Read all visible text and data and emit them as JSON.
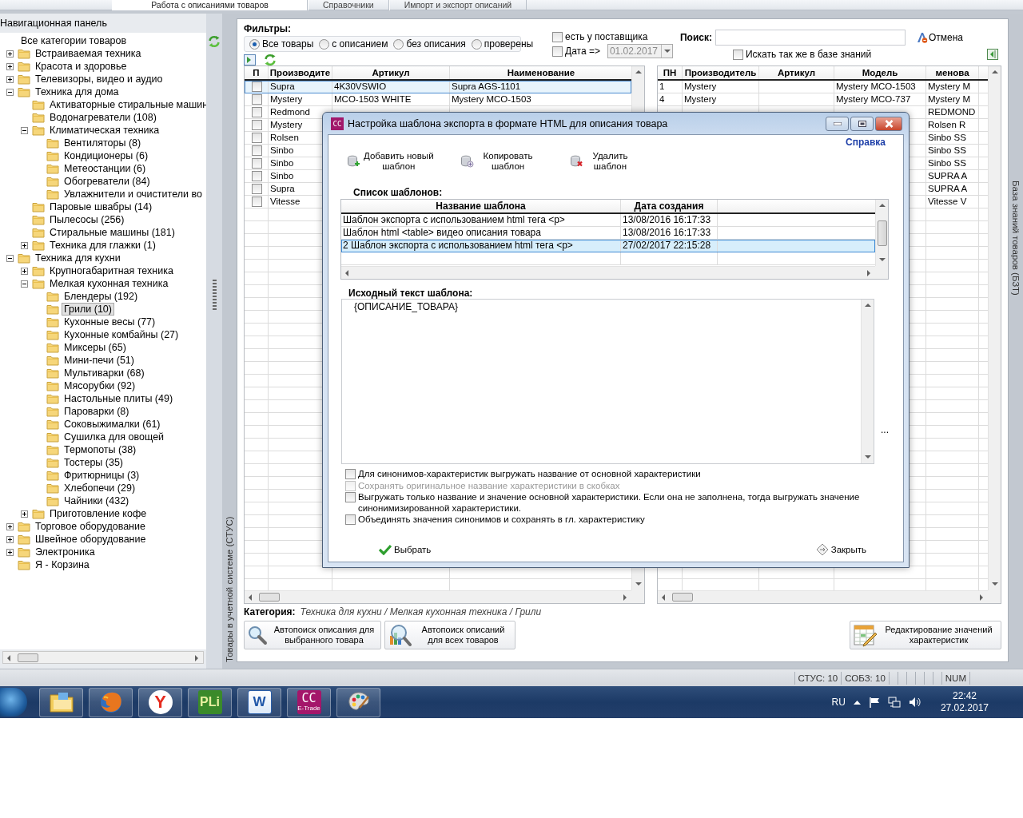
{
  "top_tabs": [
    {
      "label": "Работа с описаниями товаров",
      "selected": true
    },
    {
      "label": "Справочники",
      "selected": false
    },
    {
      "label": "Импорт и экспорт описаний",
      "selected": false
    }
  ],
  "nav_panel": {
    "title": "Навигационная панель",
    "root": "Все категории товаров",
    "tree": [
      {
        "label": "Встраиваемая техника",
        "selected": false,
        "expanded": false
      },
      {
        "label": "Красота и здоровье",
        "selected": false,
        "expanded": false
      },
      {
        "label": "Телевизоры, видео и аудио",
        "selected": false,
        "expanded": false
      },
      {
        "label": "Техника для дома",
        "selected": false,
        "expanded": true,
        "children": [
          {
            "label": "Активаторные стиральные машин",
            "selected": false
          },
          {
            "label": "Водонагреватели (108)",
            "selected": false
          },
          {
            "label": "Климатическая техника",
            "selected": false,
            "expanded": true,
            "children": [
              {
                "label": "Вентиляторы (8)",
                "selected": false
              },
              {
                "label": "Кондиционеры (6)",
                "selected": false
              },
              {
                "label": "Метеостанции (6)",
                "selected": false
              },
              {
                "label": "Обогреватели (84)",
                "selected": false
              },
              {
                "label": "Увлажнители и очистители во",
                "selected": false
              }
            ]
          },
          {
            "label": "Паровые швабры (14)",
            "selected": false
          },
          {
            "label": "Пылесосы (256)",
            "selected": false
          },
          {
            "label": "Стиральные машины (181)",
            "selected": false
          },
          {
            "label": "Техника для глажки (1)",
            "selected": false,
            "expanded": false
          }
        ]
      },
      {
        "label": "Техника для кухни",
        "selected": false,
        "expanded": true,
        "children": [
          {
            "label": "Крупногабаритная техника",
            "selected": false,
            "expanded": false
          },
          {
            "label": "Мелкая кухонная техника",
            "selected": false,
            "expanded": true,
            "children": [
              {
                "label": "Блендеры (192)",
                "selected": false
              },
              {
                "label": "Грили (10)",
                "selected": true
              },
              {
                "label": "Кухонные весы (77)",
                "selected": false
              },
              {
                "label": "Кухонные комбайны (27)",
                "selected": false
              },
              {
                "label": "Миксеры (65)",
                "selected": false
              },
              {
                "label": "Мини-печи (51)",
                "selected": false
              },
              {
                "label": "Мультиварки (68)",
                "selected": false
              },
              {
                "label": "Мясорубки (92)",
                "selected": false
              },
              {
                "label": "Настольные плиты (49)",
                "selected": false
              },
              {
                "label": "Пароварки (8)",
                "selected": false
              },
              {
                "label": "Соковыжималки (61)",
                "selected": false
              },
              {
                "label": "Сушилка для овощей",
                "selected": false
              },
              {
                "label": "Термопоты (38)",
                "selected": false
              },
              {
                "label": "Тостеры (35)",
                "selected": false
              },
              {
                "label": "Фритюрницы (3)",
                "selected": false
              },
              {
                "label": "Хлебопечи (29)",
                "selected": false
              },
              {
                "label": "Чайники (432)",
                "selected": false
              }
            ]
          },
          {
            "label": "Приготовление кофе",
            "selected": false,
            "expanded": false
          }
        ]
      },
      {
        "label": "Торговое оборудование",
        "selected": false,
        "expanded": false
      },
      {
        "label": "Швейное оборудование",
        "selected": false,
        "expanded": false
      },
      {
        "label": "Электроника",
        "selected": false,
        "expanded": false
      },
      {
        "label": "Я - Корзина",
        "selected": false
      }
    ]
  },
  "side_tabs": {
    "left": "Товары в учетной системе (СТУС)",
    "right": "База знаний товаров (БЗТ)"
  },
  "filters": {
    "title": "Фильтры:",
    "radios": [
      {
        "label": "Все товары",
        "selected": true
      },
      {
        "label": "с описанием",
        "selected": false
      },
      {
        "label": "без описания",
        "selected": false
      },
      {
        "label": "проверены",
        "selected": false
      }
    ],
    "supplier": {
      "label": "есть у поставщика",
      "checked": false
    },
    "date": {
      "label": "Дата =>",
      "checked": false,
      "value": "01.02.2017",
      "disabled": true
    },
    "search_label": "Поиск:",
    "cancel": "Отмена",
    "kb_search": {
      "label": "Искать так же в базе знаний",
      "checked": false
    }
  },
  "accounting_table": {
    "columns": [
      "П",
      "Производите",
      "Артикул",
      "Наименование"
    ],
    "rows": [
      {
        "selected": true,
        "cells": [
          {
            "checked": false
          },
          "Supra",
          "4K30VSWIO",
          "Supra AGS-1101"
        ]
      },
      {
        "selected": false,
        "cells": [
          {
            "checked": false
          },
          "Mystery",
          "MCO-1503 WHITE",
          "Mystery MCO-1503"
        ]
      },
      {
        "selected": false,
        "cells": [
          {
            "checked": false
          },
          "Redmond",
          null,
          null
        ]
      },
      {
        "selected": false,
        "cells": [
          {
            "checked": false
          },
          "Mystery",
          null,
          null
        ]
      },
      {
        "selected": false,
        "cells": [
          {
            "checked": false
          },
          "Rolsen",
          null,
          null
        ]
      },
      {
        "selected": false,
        "cells": [
          {
            "checked": false
          },
          "Sinbo",
          null,
          null
        ]
      },
      {
        "selected": false,
        "cells": [
          {
            "checked": false
          },
          "Sinbo",
          null,
          null
        ]
      },
      {
        "selected": false,
        "cells": [
          {
            "checked": false
          },
          "Sinbo",
          null,
          null
        ]
      },
      {
        "selected": false,
        "cells": [
          {
            "checked": false
          },
          "Supra",
          null,
          null
        ]
      },
      {
        "selected": false,
        "cells": [
          {
            "checked": false
          },
          "Vitesse",
          null,
          null
        ]
      }
    ]
  },
  "knowledge_table": {
    "columns": [
      "ПН",
      "Производитель",
      "Артикул",
      "Модель",
      "менова"
    ],
    "rows": [
      {
        "cells": [
          "1",
          "Mystery",
          null,
          "Mystery MCO-1503",
          "Mystery M"
        ]
      },
      {
        "cells": [
          "4",
          "Mystery",
          null,
          "Mystery MCO-737",
          "Mystery M"
        ]
      },
      {
        "cells": [
          null,
          null,
          null,
          null,
          "REDMOND"
        ]
      },
      {
        "cells": [
          null,
          null,
          null,
          null,
          "Rolsen R"
        ]
      },
      {
        "cells": [
          null,
          null,
          null,
          null,
          "Sinbo SS"
        ]
      },
      {
        "cells": [
          null,
          null,
          null,
          null,
          "Sinbo SS"
        ]
      },
      {
        "cells": [
          null,
          null,
          null,
          null,
          "Sinbo SS"
        ]
      },
      {
        "cells": [
          null,
          null,
          null,
          null,
          "SUPRA A"
        ]
      },
      {
        "cells": [
          null,
          null,
          null,
          null,
          "SUPRA A"
        ]
      },
      {
        "cells": [
          null,
          null,
          null,
          null,
          "Vitesse V"
        ]
      }
    ]
  },
  "category": {
    "label": "Категория:",
    "path": "Техника для кухни / Мелкая кухонная техника / Грили"
  },
  "actions": [
    {
      "kind": "search",
      "label": "Автопоиск описания для\nвыбранного товара"
    },
    {
      "kind": "search_all",
      "label": "Автопоиск описаний\nдля всех товаров"
    },
    {
      "kind": "edit",
      "label": "Редактирование значений\nхарактеристик"
    }
  ],
  "dialog": {
    "app_icon": "CC",
    "title": "Настройка шаблона экспорта в формате HTML для описания товара",
    "help": "Справка",
    "toolbar": [
      {
        "kind": "add",
        "label": "Добавить новый\nшаблон"
      },
      {
        "kind": "copy",
        "label": "Копировать\nшаблон"
      },
      {
        "kind": "delete",
        "label": "Удалить\nшаблон"
      }
    ],
    "list_title": "Список шаблонов:",
    "columns": [
      "Название шаблона",
      "Дата создания"
    ],
    "rows": [
      {
        "name": "Шаблон экспорта с использованием html тега <p>",
        "date": "13/08/2016 16:17:33",
        "selected": false
      },
      {
        "name": "Шаблон html <table> видео описания товара",
        "date": "13/08/2016 16:17:33",
        "selected": false
      },
      {
        "name": "2 Шаблон экспорта с использованием html тега <p>",
        "date": "27/02/2017 22:15:28",
        "selected": true
      }
    ],
    "source_title": "Исходный текст шаблона:",
    "source": "{ОПИСАНИЕ_ТОВАРА}",
    "more": "...",
    "options": [
      {
        "label": "Для синонимов-характеристик выгружать название от основной характеристики",
        "checked": false,
        "disabled": false
      },
      {
        "label": "Сохранять оригинальное название характеристики в скобках",
        "checked": false,
        "disabled": true
      },
      {
        "label": "Выгружать только название и значение основной характеристики. Если она не заполнена, тогда выгружать значение синонимизированной характеристики.",
        "checked": false,
        "disabled": false
      },
      {
        "label": "Объединять значения синонимов и сохранять в гл. характеристику",
        "checked": false,
        "disabled": false
      }
    ],
    "ok": "Выбрать",
    "close": "Закрыть"
  },
  "status_bar": [
    "СТУС: 10",
    "СОБЗ: 10",
    "NUM"
  ],
  "taskbar": {
    "apps": [
      {
        "kind": "explorer"
      },
      {
        "kind": "firefox"
      },
      {
        "kind": "yandex",
        "label": "Y"
      },
      {
        "kind": "pli",
        "label": "PLi"
      },
      {
        "kind": "word",
        "label": "W"
      },
      {
        "kind": "etrade",
        "label": "CC",
        "sublabel": "E-Trade"
      },
      {
        "kind": "paint"
      }
    ],
    "language": "RU",
    "time": "22:42",
    "date": "27.02.2017"
  }
}
